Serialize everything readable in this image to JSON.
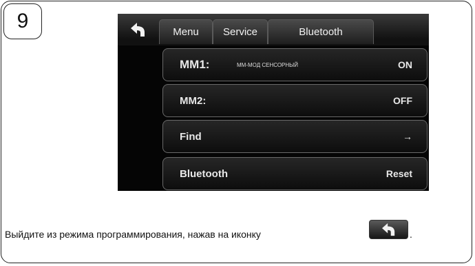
{
  "step": {
    "number": "9"
  },
  "screen": {
    "tabs": [
      {
        "label": "Menu"
      },
      {
        "label": "Service"
      },
      {
        "label": "Bluetooth"
      }
    ],
    "rows": [
      {
        "label": "MM1:",
        "sublabel": "ММ-МОД СЕНСОРНЫЙ",
        "value": "ON"
      },
      {
        "label": "MM2:",
        "value": "OFF"
      },
      {
        "label": "Find",
        "value": "→"
      },
      {
        "label": "Bluetooth",
        "value": "Reset"
      }
    ]
  },
  "instruction": {
    "text": "Выйдите из режима программирования, нажав на иконку",
    "end": "."
  },
  "icons": {
    "back": "back-arrow-icon",
    "find": "right-arrow-icon"
  },
  "colors": {
    "screen_bg": "#050505",
    "text": "#e8e8e8"
  }
}
